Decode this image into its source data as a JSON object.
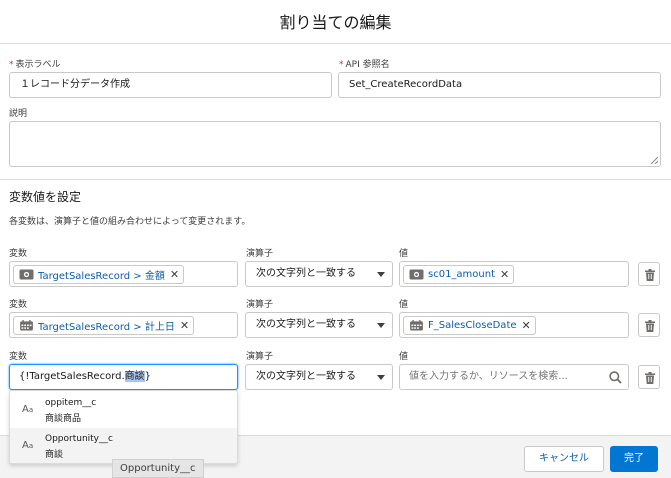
{
  "modal": {
    "title": "割り当ての編集"
  },
  "form": {
    "label_field": {
      "label": "表示ラベル",
      "required": "*",
      "value": "１レコード分データ作成"
    },
    "api_field": {
      "label": "API 参照名",
      "required": "*",
      "value": "Set_CreateRecordData"
    },
    "description": {
      "label": "説明",
      "value": ""
    }
  },
  "section": {
    "title": "変数値を設定",
    "description": "各変数は、演算子と値の組み合わせによって変更されます。"
  },
  "rows": [
    {
      "variable_label": "変数",
      "variable": "TargetSalesRecord > 金額",
      "variable_icon": "currency-icon",
      "operator_label": "演算子",
      "operator": "次の文字列と一致する",
      "value_label": "値",
      "value": "sc01_amount",
      "value_icon": "currency-icon"
    },
    {
      "variable_label": "変数",
      "variable": "TargetSalesRecord > 計上日",
      "variable_icon": "calendar-icon",
      "operator_label": "演算子",
      "operator": "次の文字列と一致する",
      "value_label": "値",
      "value": "F_SalesCloseDate",
      "value_icon": "calendar-icon"
    },
    {
      "variable_label": "変数",
      "variable_prefix": "{!TargetSalesRecord.",
      "variable_selected": "商談",
      "variable_suffix": "}",
      "operator_label": "演算子",
      "operator": "次の文字列と一致する",
      "value_label": "値",
      "value_placeholder": "値を入力するか、リソースを検索..."
    }
  ],
  "suggestions": [
    {
      "icon": "text-type-icon",
      "name": "oppitem__c",
      "sub": "商談商品"
    },
    {
      "icon": "text-type-icon",
      "name": "Opportunity__c",
      "sub": "商談"
    }
  ],
  "tooltip": "Opportunity__c",
  "footer": {
    "cancel_label": "キャンセル",
    "done_label": "完了"
  },
  "colors": {
    "brand": "#0176d3",
    "link": "#0b5cab",
    "focus": "#1b96ff",
    "required": "#c23934"
  }
}
